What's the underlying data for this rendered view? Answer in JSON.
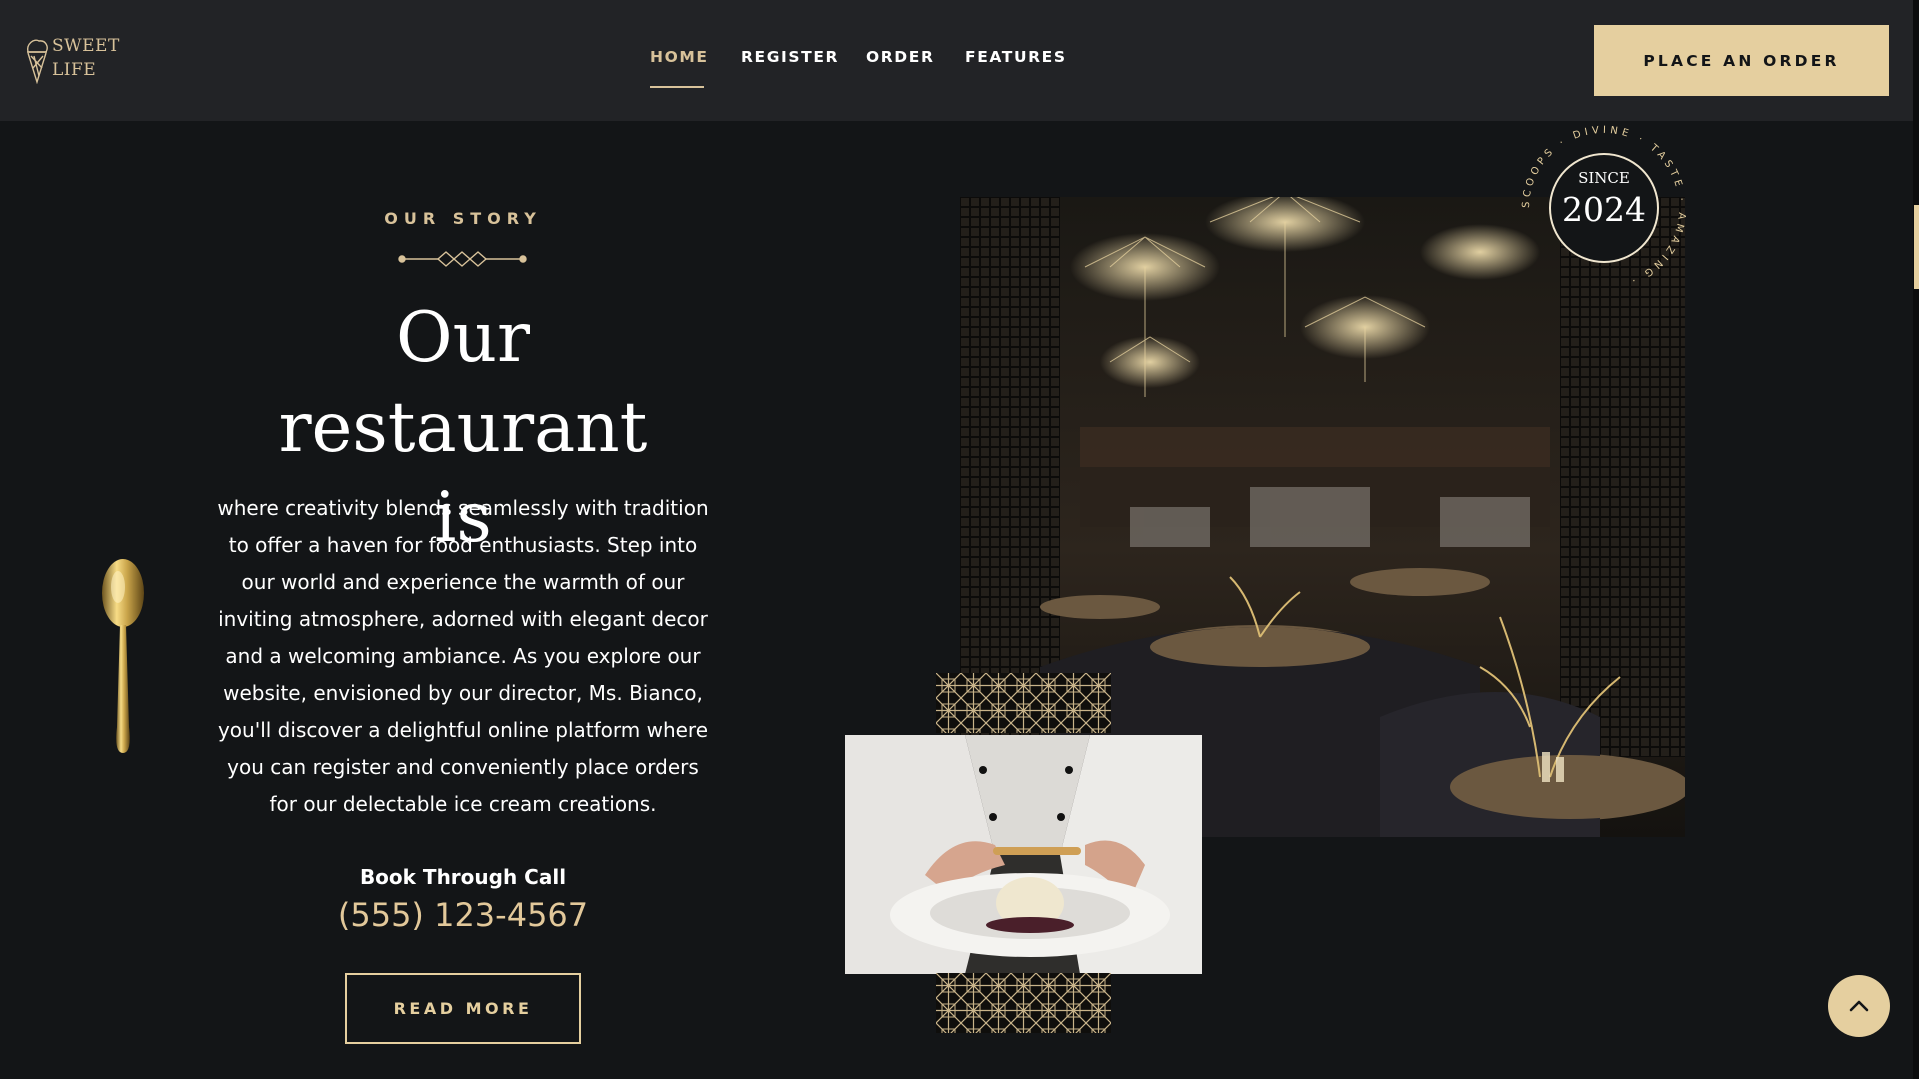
{
  "brand": {
    "logo_line1": "SWEET",
    "logo_line2": "LIFE"
  },
  "nav": {
    "items": [
      {
        "label": "HOME",
        "active": true
      },
      {
        "label": "REGISTER",
        "active": false
      },
      {
        "label": "ORDER",
        "active": false
      },
      {
        "label": "FEATURES",
        "active": false
      }
    ],
    "cta_label": "PLACE AN ORDER"
  },
  "story": {
    "label": "OUR STORY",
    "headline_line1": "Our restaurant",
    "headline_line2": "is",
    "body": "where creativity blends seamlessly with tradition to offer a haven for food enthusiasts. Step into our world and experience the warmth of our inviting atmosphere, adorned with elegant decor and a welcoming ambiance. As you explore our website, envisioned by our director, Ms. Bianco, you'll discover a delightful online platform where you can register and conveniently place orders for our delectable ice cream creations.",
    "book_label": "Book Through Call",
    "phone": "(555) 123-4567",
    "read_more_label": "READ MORE"
  },
  "badge": {
    "since_label": "SINCE",
    "year": "2024",
    "ring_text": "SCOOPS · DIVINE · TASTE · AMAZING ·"
  },
  "icons": {
    "logo": "ice-cream-cone-icon",
    "divider": "diamond-divider-icon",
    "spoon": "gold-spoon-icon",
    "scroll_top": "chevron-up-icon"
  },
  "colors": {
    "accent": "#e5cf9f",
    "accent_text": "#d8c29a",
    "background": "#131517",
    "header_background": "#222326"
  }
}
